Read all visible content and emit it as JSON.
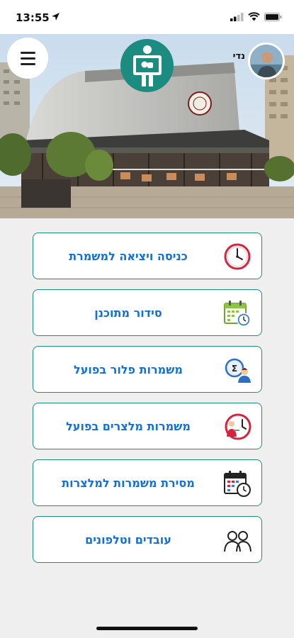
{
  "status_bar": {
    "time": "13:55"
  },
  "header": {
    "user_name": "נדי"
  },
  "menu": [
    {
      "label": "כניסה ויציאה למשמרת",
      "icon": "clock-icon"
    },
    {
      "label": "סידור מתוכנן",
      "icon": "calendar-clock-icon"
    },
    {
      "label": "משמרות פלור בפועל",
      "icon": "person-clock-icon"
    },
    {
      "label": "משמרות מלצרים בפועל",
      "icon": "waiter-clock-icon"
    },
    {
      "label": "מסירת משמרות למלצרות",
      "icon": "calendar-clock-dark-icon"
    },
    {
      "label": "עובדים וטלפונים",
      "icon": "users-icon"
    }
  ],
  "colors": {
    "accent": "#1c8b80",
    "button_text": "#1270d6",
    "background": "#efefef"
  }
}
